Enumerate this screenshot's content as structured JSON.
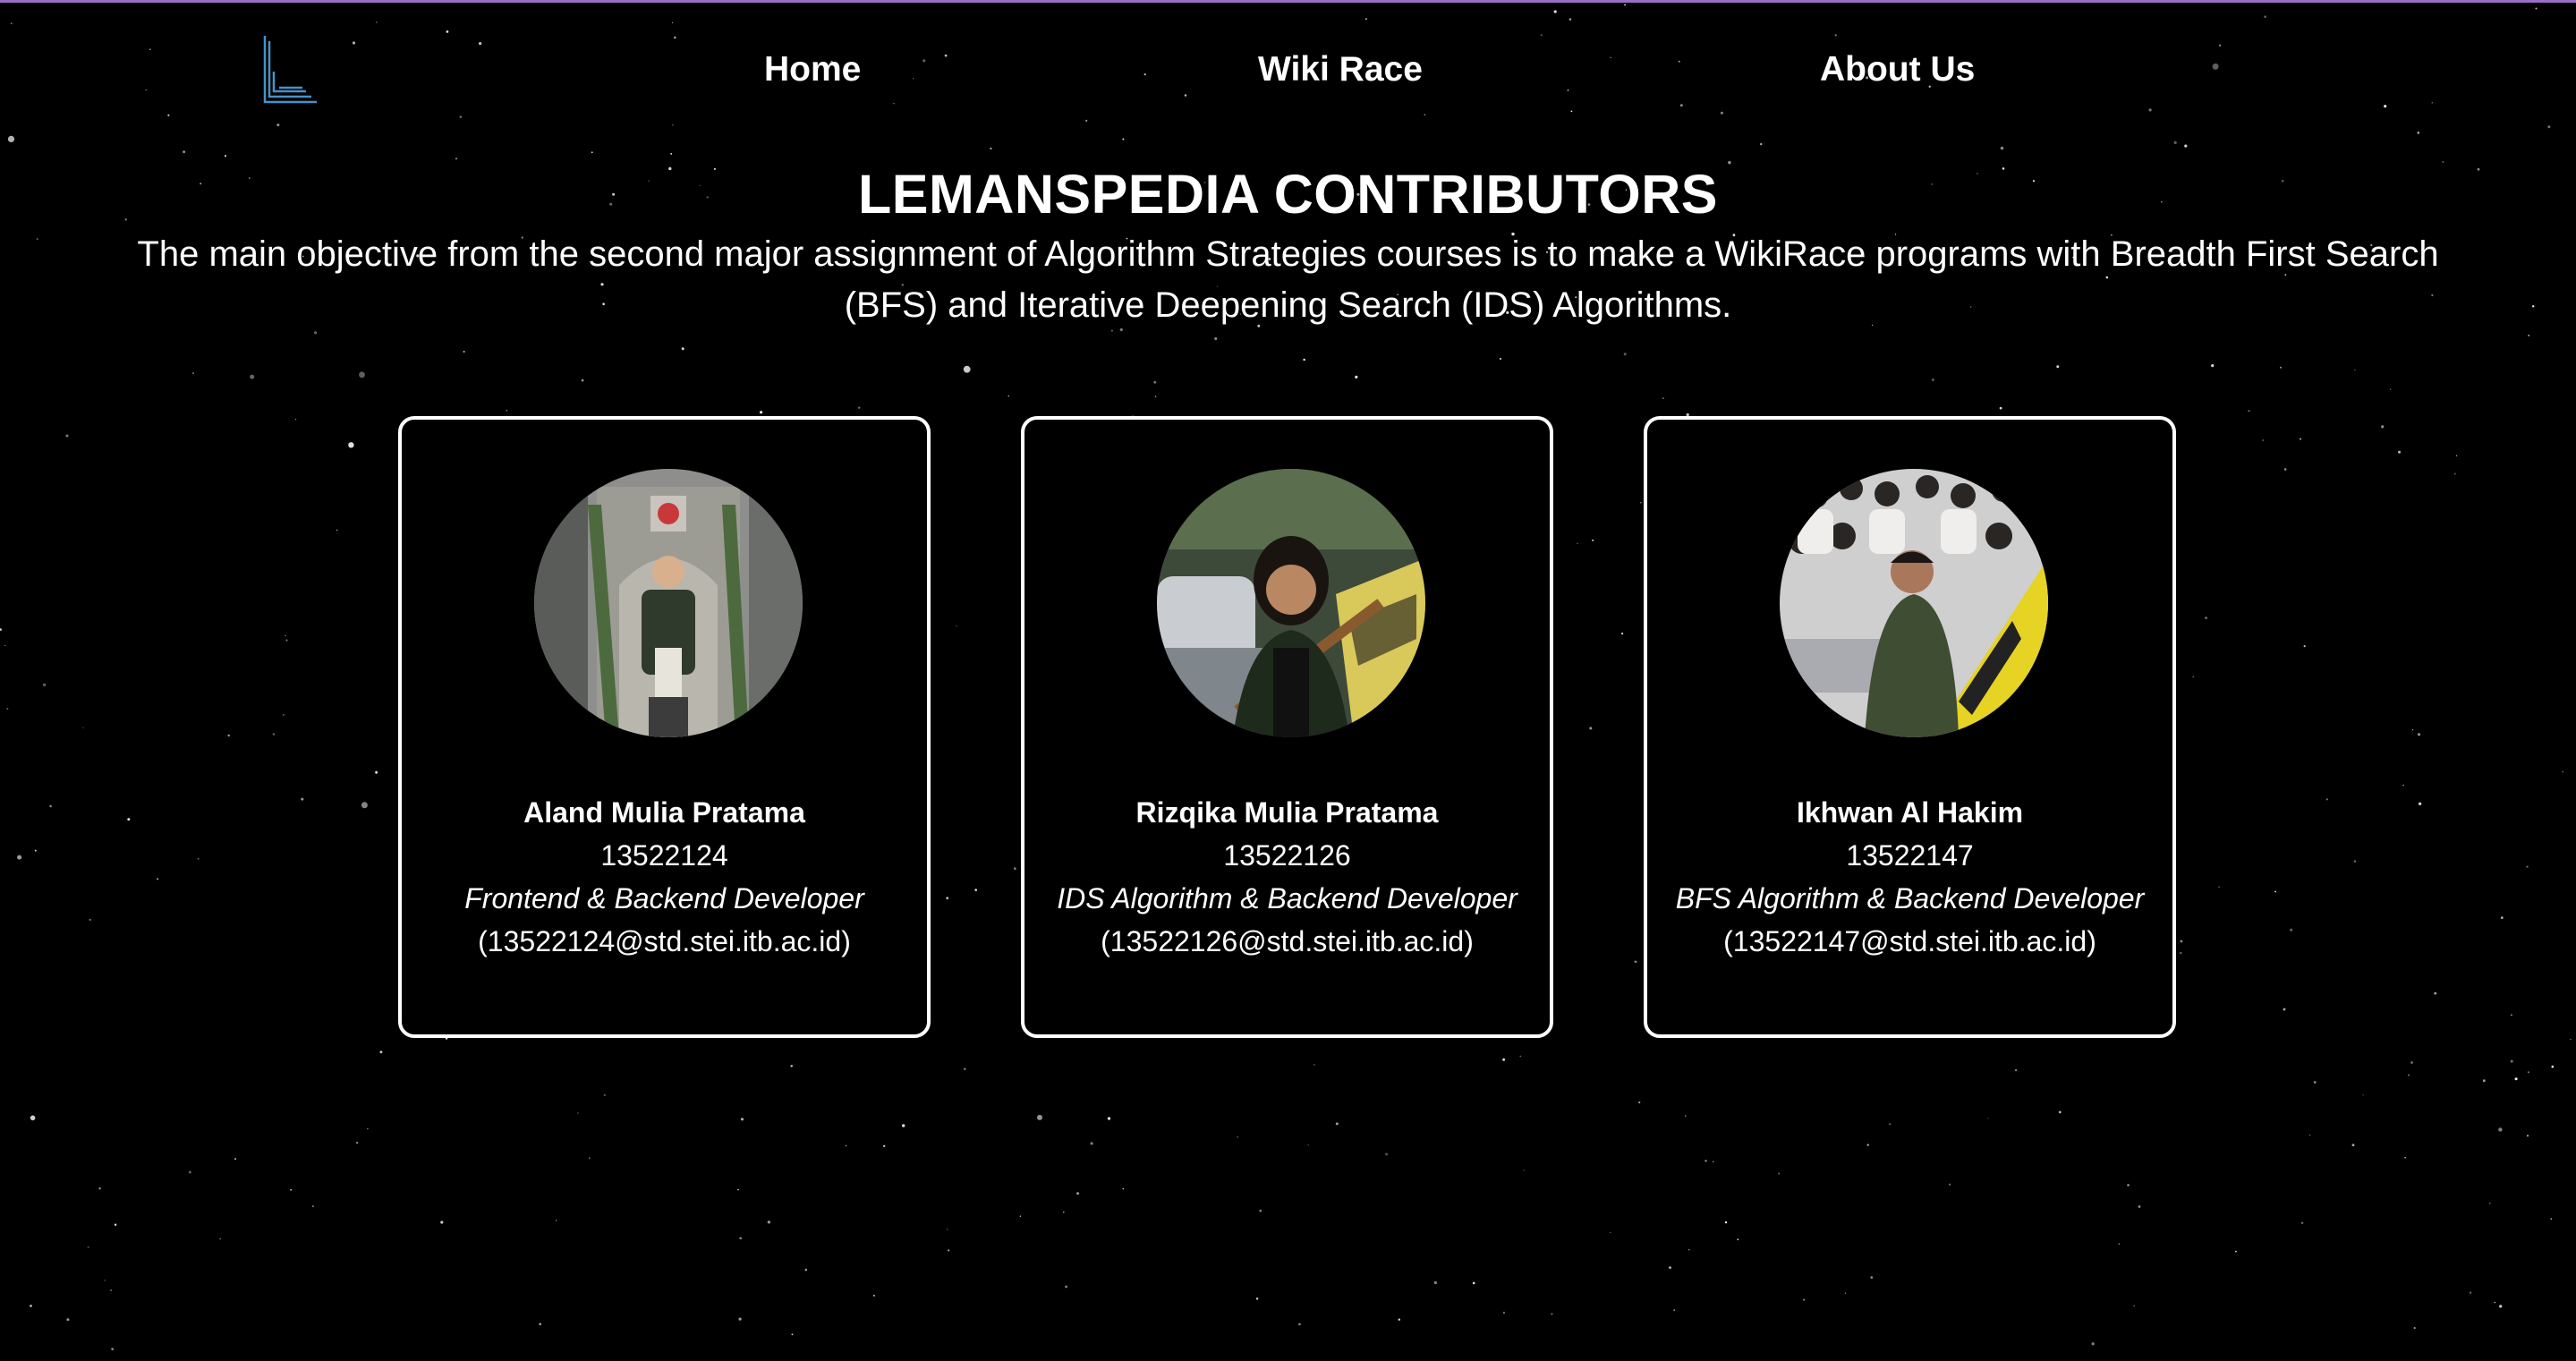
{
  "nav": {
    "logo_icon": "lemanspedia-logo-icon",
    "links": [
      {
        "label": "Home"
      },
      {
        "label": "Wiki Race"
      },
      {
        "label": "About Us"
      }
    ]
  },
  "header": {
    "title": "LEMANSPEDIA CONTRIBUTORS",
    "description": "The main objective from the second major assignment of Algorithm Strategies courses is to make a WikiRace programs with Breadth First Search (BFS) and Iterative Deepening Search (IDS) Algorithms."
  },
  "members": [
    {
      "name": "Aland Mulia Pratama",
      "nim": "13522124",
      "role": "Frontend & Backend Developer",
      "email": "(13522124@std.stei.itb.ac.id)",
      "avatar_icon": "member-photo"
    },
    {
      "name": "Rizqika Mulia Pratama",
      "nim": "13522126",
      "role": "IDS Algorithm & Backend Developer",
      "email": "(13522126@std.stei.itb.ac.id)",
      "avatar_icon": "member-photo"
    },
    {
      "name": "Ikhwan Al Hakim",
      "nim": "13522147",
      "role": "BFS Algorithm & Backend Developer",
      "email": "(13522147@std.stei.itb.ac.id)",
      "avatar_icon": "member-photo"
    }
  ],
  "colors": {
    "background": "#000000",
    "text": "#ffffff",
    "logo": "#4a90c8",
    "top_border": "#9a6fc6"
  }
}
